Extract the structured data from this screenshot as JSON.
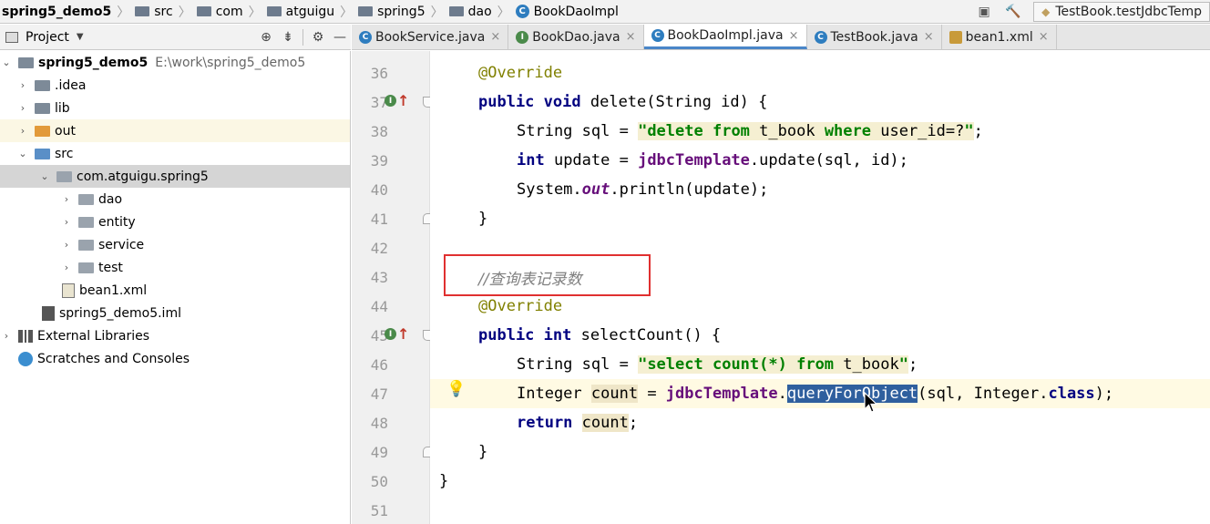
{
  "breadcrumb": {
    "items": [
      "spring5_demo5",
      "src",
      "com",
      "atguigu",
      "spring5",
      "dao",
      "BookDaoImpl"
    ],
    "run_config": "TestBook.testJdbcTemp"
  },
  "project_panel": {
    "title": "Project",
    "tree": [
      {
        "label": "spring5_demo5",
        "hint": "E:\\work\\spring5_demo5"
      },
      {
        "label": ".idea"
      },
      {
        "label": "lib"
      },
      {
        "label": "out"
      },
      {
        "label": "src"
      },
      {
        "label": "com.atguigu.spring5"
      },
      {
        "label": "dao"
      },
      {
        "label": "entity"
      },
      {
        "label": "service"
      },
      {
        "label": "test"
      },
      {
        "label": "bean1.xml"
      },
      {
        "label": "spring5_demo5.iml"
      },
      {
        "label": "External Libraries"
      },
      {
        "label": "Scratches and Consoles"
      }
    ]
  },
  "tabs": [
    {
      "label": "BookService.java",
      "icon": "class-icon"
    },
    {
      "label": "BookDao.java",
      "icon": "interface-icon"
    },
    {
      "label": "BookDaoImpl.java",
      "icon": "class-icon",
      "active": true
    },
    {
      "label": "TestBook.java",
      "icon": "test-class-icon"
    },
    {
      "label": "bean1.xml",
      "icon": "xml-icon"
    }
  ],
  "editor": {
    "line_numbers": [
      "36",
      "37",
      "38",
      "39",
      "40",
      "41",
      "42",
      "43",
      "44",
      "45",
      "46",
      "47",
      "48",
      "49",
      "50",
      "51"
    ],
    "code": {
      "l36": {
        "ann": "@Override"
      },
      "l37": {
        "kw1": "public",
        "kw2": "void",
        "rest": " delete(String id) {"
      },
      "l38": {
        "pre": "String sql = ",
        "q1": "\"",
        "s1": "delete",
        "s2": " from",
        "s3": " t_book ",
        "s4": "where",
        "s5": " user_id=?",
        "q2": "\"",
        "post": ";"
      },
      "l39": {
        "kw": "int",
        "pre": " update = ",
        "fld": "jdbcTemplate",
        "post": ".update(sql, id);"
      },
      "l40": {
        "pre": "System.",
        "fld": "out",
        "post": ".println(update);"
      },
      "l41": {
        "text": "}"
      },
      "l43": {
        "comment": "//查询表记录数"
      },
      "l44": {
        "ann": "@Override"
      },
      "l45": {
        "kw1": "public",
        "kw2": "int",
        "rest": " selectCount() {"
      },
      "l46": {
        "pre": "String sql = ",
        "q1": "\"",
        "s1": "select",
        "s2": " count(*)",
        "s3": " from",
        "s4": " t_book",
        "q2": "\"",
        "post": ";"
      },
      "l47": {
        "pre": "Integer ",
        "var": "count",
        "mid": " = ",
        "fld": "jdbcTemplate",
        "dot": ".",
        "sel": "queryForObject",
        "post1": "(sql, Integer.",
        "kw": "class",
        "post2": ");"
      },
      "l48": {
        "kw": "return",
        "sp": " ",
        "var": "count",
        "post": ";"
      },
      "l49": {
        "text": "}"
      },
      "l50": {
        "text": "}"
      }
    }
  }
}
